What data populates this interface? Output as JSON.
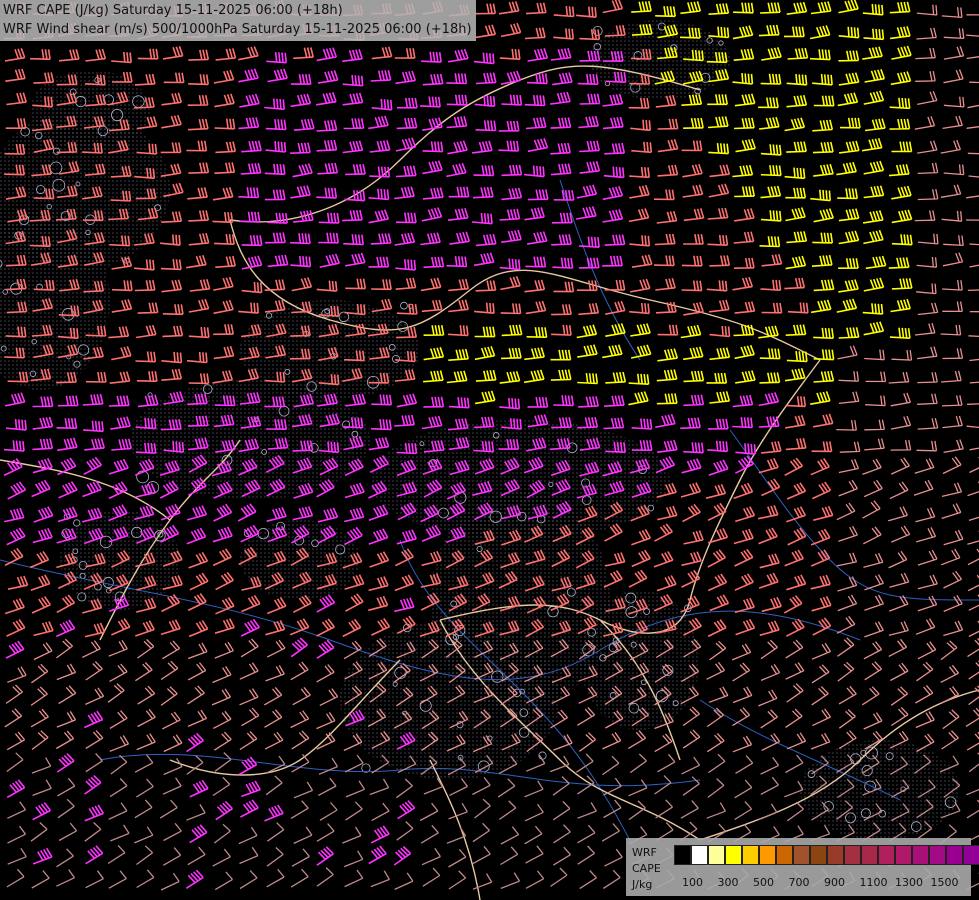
{
  "header": {
    "line1": "WRF CAPE (J/kg) Saturday 15-11-2025 06:00 (+18h)",
    "line2": "WRF Wind shear (m/s) 500/1000hPa Saturday 15-11-2025 06:00 (+18h)"
  },
  "legend": {
    "model": "WRF",
    "variable": "CAPE",
    "unit": "J/kg",
    "colors": [
      "#000000",
      "#ffffff",
      "#ffff99",
      "#ffff00",
      "#ffcc00",
      "#ff9900",
      "#cc6600",
      "#a0522d",
      "#8b4513",
      "#9a3b2a",
      "#a23040",
      "#a8284a",
      "#b0205a",
      "#b01868",
      "#a81078",
      "#a00a85",
      "#9a0090",
      "#920098"
    ],
    "tick_labels": [
      "100",
      "300",
      "500",
      "700",
      "900",
      "1100",
      "1300",
      "1500"
    ]
  },
  "map_colors": {
    "barb_low": "#c08a8a",
    "barb_mid": "#e89090",
    "barb_strong": "#ff7070",
    "barb_magenta": "#ff33ff",
    "barb_yellow": "#ffff00",
    "border": "#e8c8a0",
    "river": "#3060c0",
    "contour": "#b0b0c8"
  }
}
